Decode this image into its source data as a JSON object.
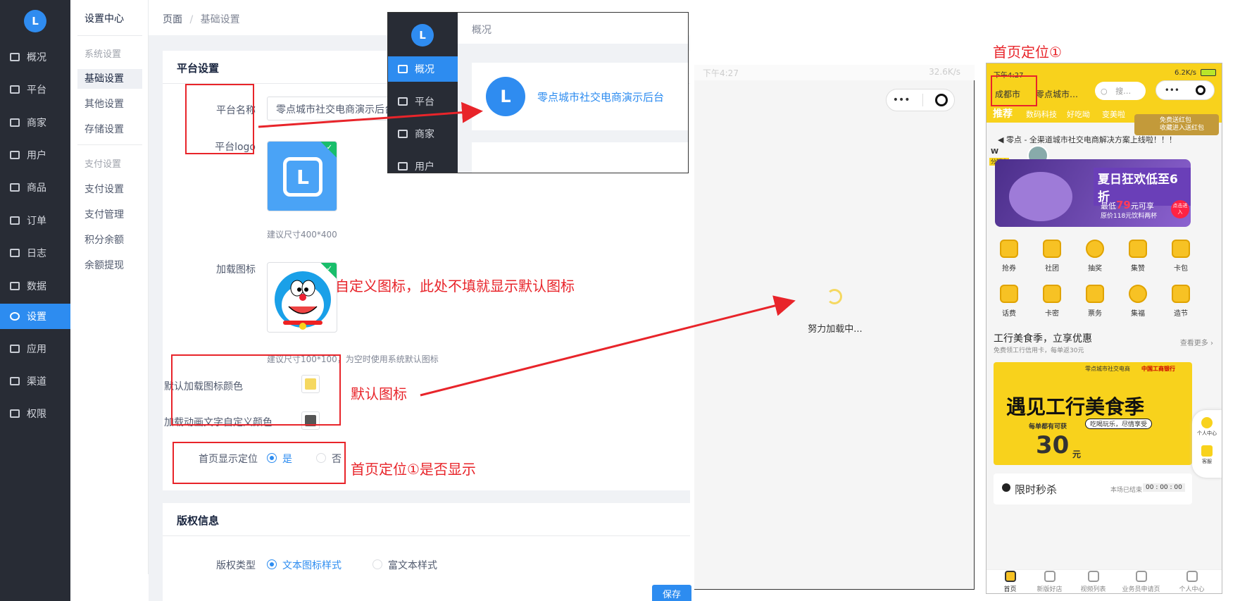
{
  "nav": {
    "items": [
      {
        "label": "概况",
        "icon": "dashboard-icon"
      },
      {
        "label": "平台",
        "icon": "monitor-icon"
      },
      {
        "label": "商家",
        "icon": "shop-icon"
      },
      {
        "label": "用户",
        "icon": "user-icon"
      },
      {
        "label": "商品",
        "icon": "goods-icon"
      },
      {
        "label": "订单",
        "icon": "order-icon"
      },
      {
        "label": "日志",
        "icon": "log-icon"
      },
      {
        "label": "数据",
        "icon": "chart-icon"
      },
      {
        "label": "设置",
        "icon": "gear-icon"
      },
      {
        "label": "应用",
        "icon": "apps-icon"
      },
      {
        "label": "渠道",
        "icon": "box-icon"
      },
      {
        "label": "权限",
        "icon": "lock-icon"
      }
    ]
  },
  "subnav": {
    "title": "设置中心",
    "group1": "系统设置",
    "items1": [
      "基础设置",
      "其他设置",
      "存储设置"
    ],
    "group2": "支付设置",
    "items2": [
      "支付设置",
      "支付管理",
      "积分余额",
      "余额提现"
    ]
  },
  "breadcrumb": {
    "root": "页面",
    "sep": "/",
    "current": "基础设置"
  },
  "platform": {
    "title": "平台设置",
    "name_label": "平台名称",
    "name_value": "零点城市社交电商演示后台",
    "logo_label": "平台logo",
    "logo_hint": "建议尺寸400*400",
    "loading_icon_label": "加载图标",
    "loading_icon_hint": "建议尺寸100*100，为空时使用系统默认图标",
    "default_color_label": "默认加载图标颜色",
    "default_color": "#f5d860",
    "text_color_label": "加载动画文字自定义颜色",
    "text_color": "#555555",
    "location_label": "首页显示定位",
    "yes": "是",
    "no": "否"
  },
  "copyright": {
    "title": "版权信息",
    "type_label": "版权类型",
    "option1": "文本图标样式",
    "option2": "富文本样式"
  },
  "save_label": "保存",
  "annotations": {
    "custom_icon": "自定义图标，此处不填就显示默认图标",
    "default_icon": "默认图标",
    "location_show": "首页定位①是否显示",
    "location_title": "首页定位①"
  },
  "popup": {
    "header": "概况",
    "nav": [
      "概况",
      "平台",
      "商家",
      "用户"
    ],
    "brand": "零点城市社交电商演示后台"
  },
  "loading": {
    "status_bar_time": "下午4:27",
    "status_bar_speed": "32.6K/s",
    "text": "努力加载中..."
  },
  "phone": {
    "time": "下午4:27",
    "speed": "6.2K/s",
    "city": "成都市",
    "platform_short": "零点城市…",
    "search_placeholder": "搜…",
    "tabs": [
      "推荐",
      "数码科技",
      "好吃呦",
      "变美啦"
    ],
    "promo_line1": "免费送红包",
    "promo_line2": "收藏进入送红包",
    "notice": "零点 - 全渠道城市社交电商解决方案上线啦！！！",
    "user_initial": "W",
    "user_badge": "分销商",
    "banner_title": "夏日狂欢低至6折",
    "banner_sub1": "最低",
    "banner_price": "79",
    "banner_sub2": "元可享",
    "banner_sub3": "原价118元饮料两杯",
    "banner_cta": "点击进入",
    "grid": [
      "抢券",
      "社团",
      "抽奖",
      "集赞",
      "卡包",
      "话费",
      "卡密",
      "票务",
      "集福",
      "造节"
    ],
    "section_title": "工行美食季，立享优惠",
    "section_sub": "免费领工行信用卡，每单返30元",
    "section_more": "查看更多",
    "bank_banner_brand1": "零点城市社交电商",
    "bank_banner_brand2": "中国工商银行",
    "bank_banner_title": "遇见工行美食季",
    "bank_banner_sub": "每单都有可获",
    "bank_banner_amount": "30",
    "bank_banner_unit": "元",
    "bank_banner_tag": "吃喝玩乐，尽情享受",
    "side_btn1": "个人中心",
    "side_btn2": "客服",
    "flash_title": "限时秒杀",
    "flash_sub": "本场已结束",
    "flash_time": "00 : 00 : 00",
    "bottom_tabs": [
      "首页",
      "新版好店",
      "视频列表",
      "业务员申请页",
      "个人中心"
    ]
  }
}
